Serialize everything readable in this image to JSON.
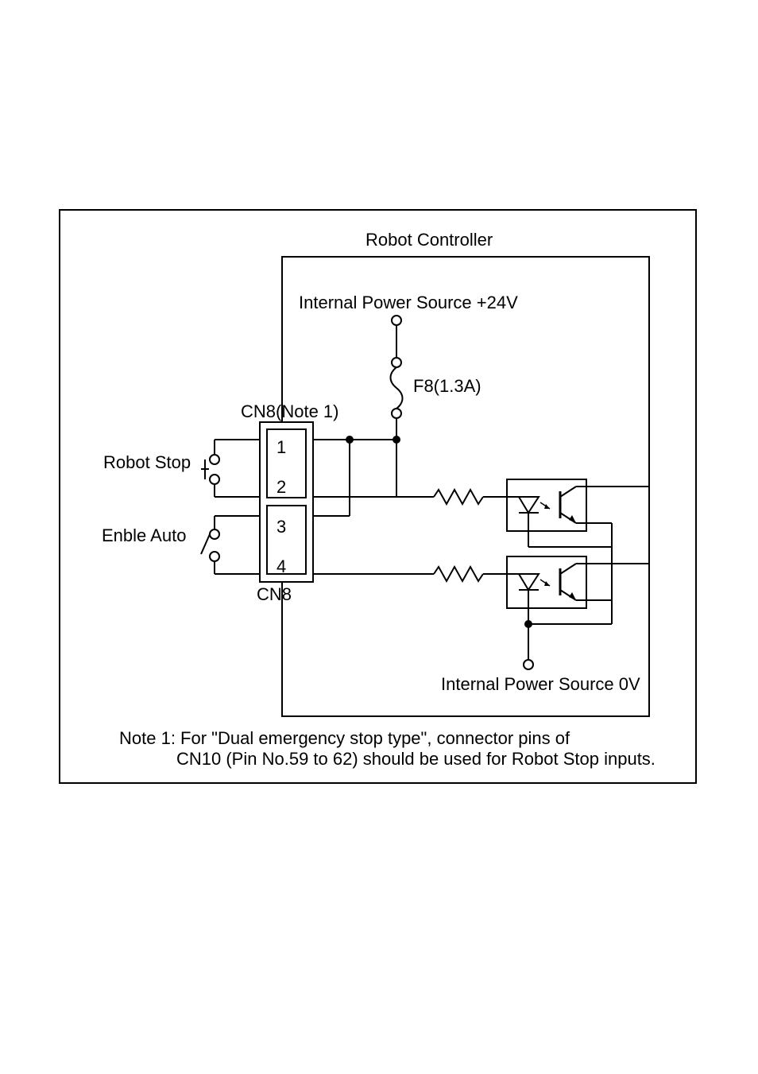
{
  "title": "Robot Controller",
  "power24": "Internal Power Source +24V",
  "fuse": "F8(1.3A)",
  "connTop": "CN8(Note 1)",
  "connBot": "CN8",
  "pin1": "1",
  "pin2": "2",
  "pin3": "3",
  "pin4": "4",
  "robotStop": "Robot Stop",
  "enableAuto": "Enble Auto",
  "power0": "Internal Power Source 0V",
  "note1a": "Note 1: For \"Dual emergency stop type\", connector pins of",
  "note1b": "CN10 (Pin No.59 to 62) should be used for Robot Stop inputs."
}
